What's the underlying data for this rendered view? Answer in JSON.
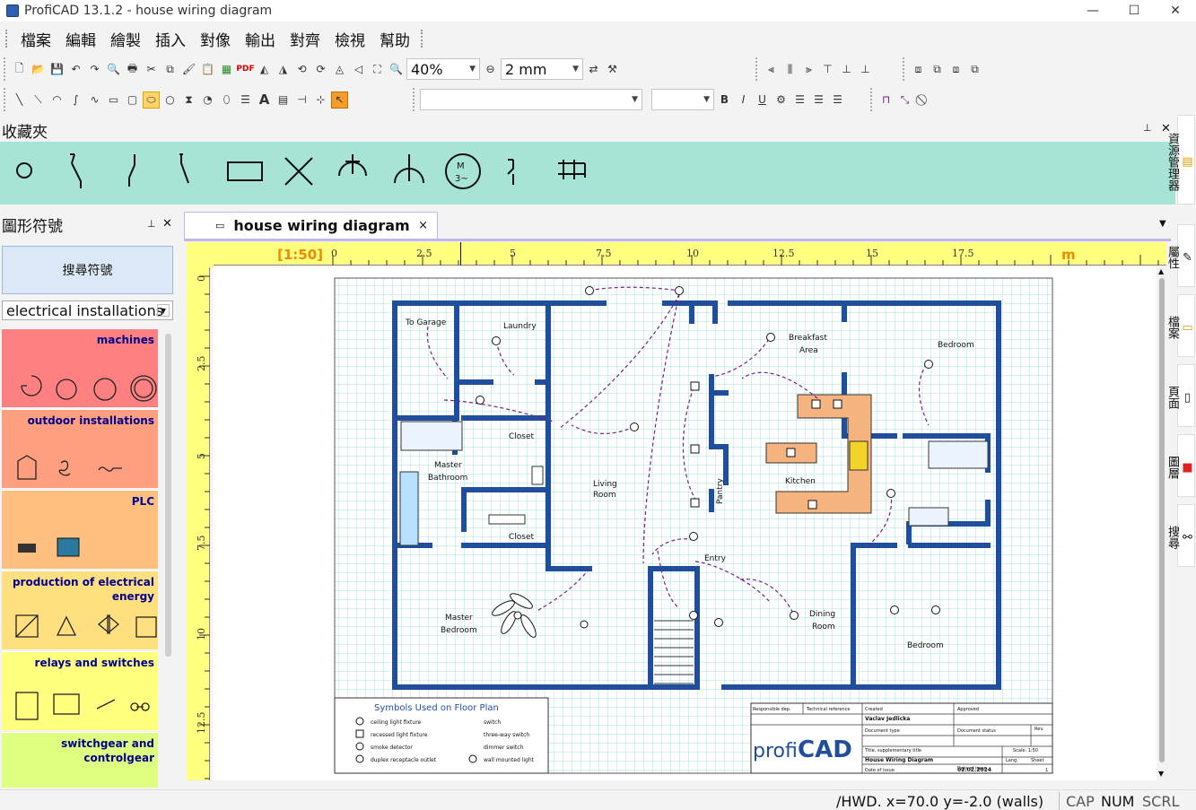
{
  "window": {
    "title": "ProfiCAD 13.1.2 - house wiring diagram",
    "minimize": "—",
    "maximize": "☐",
    "close": "✕"
  },
  "menu": [
    "檔案",
    "編輯",
    "繪製",
    "插入",
    "對像",
    "輸出",
    "對齊",
    "檢視",
    "幫助"
  ],
  "toolbar": {
    "zoom_value": "40%",
    "grid_value": "2 mm",
    "font_combo": "",
    "size_combo": ""
  },
  "favorites": {
    "title": "收藏夾",
    "pin": "📌",
    "close": "✕"
  },
  "symbols_panel": {
    "title": "圖形符號",
    "search_button": "搜尋符號",
    "category_select": "electrical installations",
    "categories": [
      {
        "label": "machines",
        "color": "#ff8080"
      },
      {
        "label": "outdoor installations",
        "color": "#ff9f80"
      },
      {
        "label": "PLC",
        "color": "#ffbf80"
      },
      {
        "label": "production of electrical energy",
        "color": "#ffdf80"
      },
      {
        "label": "relays and switches",
        "color": "#ffff80"
      },
      {
        "label": "switchgear and controlgear",
        "color": "#dfff80"
      }
    ]
  },
  "document": {
    "tab_label": "house wiring diagram",
    "tab_close": "×",
    "scale_label": "[1:50]",
    "unit_label": "m",
    "hruler_ticks": [
      "0",
      "2.5",
      "5",
      "7.5",
      "10",
      "12.5",
      "15",
      "17.5"
    ],
    "vruler_ticks": [
      "0",
      "2.5",
      "5",
      "7.5",
      "10",
      "12.5"
    ]
  },
  "drawing": {
    "rooms": [
      "To Garage",
      "Laundry",
      "Breakfast",
      "Area",
      "Bedroom",
      "Closet",
      "Master",
      "Bathroom",
      "Living",
      "Room",
      "Kitchen",
      "Pantry",
      "Closet",
      "Entry",
      "Master",
      "Bedroom",
      "Dining",
      "Room",
      "Bedroom"
    ],
    "legend_title": "Symbols Used on Floor Plan",
    "legend_items": [
      "ceiling light fixture",
      "recessed light fixture",
      "smoke detector",
      "duplex receptacle outlet",
      "switch",
      "three-way switch",
      "dimmer switch",
      "wall mounted light"
    ],
    "titleblock": {
      "responsible": "Responsible dep.",
      "technical": "Technical reference",
      "created": "Created",
      "created_by": "Vaclav Jedlicka",
      "approved": "Approved",
      "doc_type": "Document type",
      "doc_status": "Document status",
      "rev": "Rev.",
      "title_lbl": "Title, supplementary title",
      "title": "House Wiring Diagram",
      "scale": "Scale: 1:50",
      "date_lbl": "Date of issue",
      "date": "02.02.2024",
      "lang": "Lang.",
      "sheet": "Sheet",
      "sheet_no": "1",
      "logo_a": "profi",
      "logo_b": "CAD"
    }
  },
  "right_dock": [
    "資源管理器",
    "屬性",
    "檔案",
    "頁面",
    "圖層",
    "搜尋"
  ],
  "statusbar": {
    "coords": "/HWD.  x=70.0  y=-2.0 (walls)",
    "cap": "CAP",
    "num": "NUM",
    "scrl": "SCRL"
  },
  "colors": {
    "wall": "#1f4e9c",
    "grid": "#8fdede",
    "favorites_bg": "#a8e4d5",
    "ruler_bg": "#ffff80",
    "wiring": "#7a1f8a"
  }
}
